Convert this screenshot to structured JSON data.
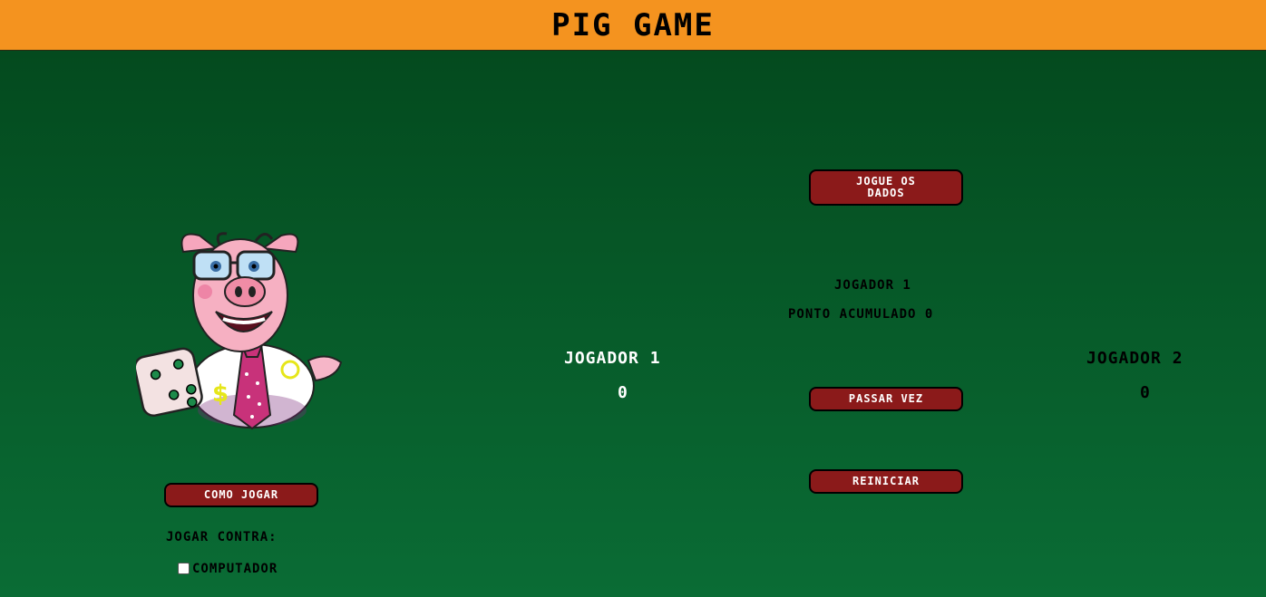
{
  "header": {
    "title": "PIG GAME"
  },
  "left_panel": {
    "how_to_play_label": "COMO JOGAR",
    "play_against_label": "JOGAR CONTRA:",
    "computer_label": "COMPUTADOR",
    "computer_checked": false
  },
  "player1": {
    "name": "JOGADOR 1",
    "score": "0"
  },
  "player2": {
    "name": "JOGADOR 2",
    "score": "0"
  },
  "center": {
    "roll_dice_label": "JOGUE OS DADOS",
    "current_player": "JOGADOR 1",
    "accumulated": "PONTO ACUMULADO 0",
    "pass_turn_label": "PASSAR VEZ",
    "restart_label": "REINICIAR"
  },
  "colors": {
    "header_bg": "#f4931f",
    "button_bg": "#8b1a1a",
    "background_top": "#03471c",
    "background_bottom": "#0a6c35"
  }
}
